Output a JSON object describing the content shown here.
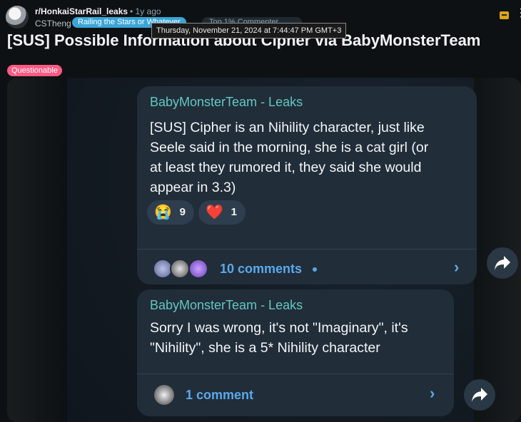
{
  "post": {
    "subreddit": "r/HonkaiStarRail_leaks",
    "age": "• 1y ago",
    "author": "CSTheng",
    "flair": "Railing the Stars or Whatever",
    "top_badge": "Top 1% Commenter",
    "tooltip": "Thursday, November 21, 2024 at 7:44:47 PM GMT+3",
    "title": "[SUS] Possible Information about Cipher via BabyMonsterTeam",
    "tag": "Questionable",
    "menu_glyph": "⋮"
  },
  "screenshot": {
    "message1": {
      "author": "BabyMonsterTeam - Leaks",
      "text": "[SUS] Cipher is an Nihility character, just like\nSeele said in the morning, she is a cat girl (or\nat least they rumored it, they said she would\nappear in 3.3)",
      "reactions": [
        {
          "emoji": "😭",
          "count": "9"
        },
        {
          "emoji": "❤️",
          "count": "1"
        }
      ],
      "comments": "10 comments",
      "chevron": "›"
    },
    "message2": {
      "author": "BabyMonsterTeam - Leaks",
      "text": "Sorry I was wrong, it's not \"Imaginary\", it's\n\"Nihility\", she is a 5* Nihility character",
      "comments": "1 comment",
      "chevron": "›"
    }
  },
  "colors": {
    "author": "#62c7c1",
    "link": "#5aa9ec",
    "tag": "#ff5a83",
    "flair": "#3aa6d8"
  }
}
